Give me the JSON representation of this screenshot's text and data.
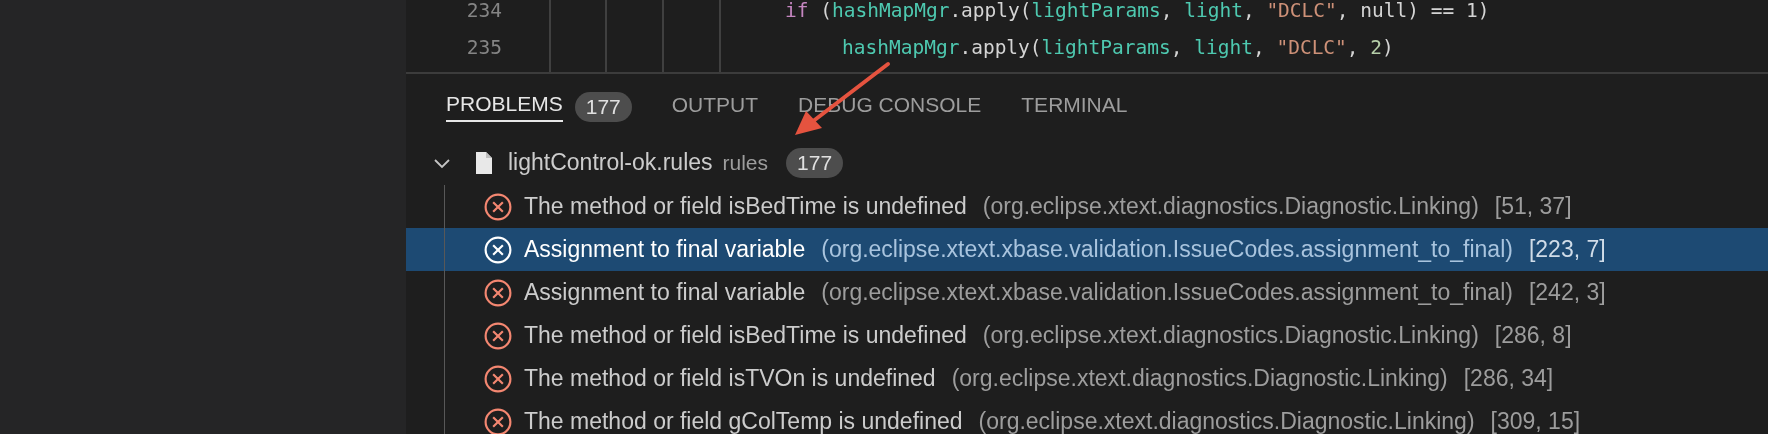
{
  "editor": {
    "lines": [
      {
        "number": "234",
        "code": [
          {
            "kind": "keyword",
            "text": "if"
          },
          {
            "kind": "plain",
            "text": " ("
          },
          {
            "kind": "ident",
            "text": "hashMapMgr"
          },
          {
            "kind": "plain",
            "text": ".apply("
          },
          {
            "kind": "ident",
            "text": "lightParams"
          },
          {
            "kind": "plain",
            "text": ", "
          },
          {
            "kind": "ident",
            "text": "light"
          },
          {
            "kind": "plain",
            "text": ", "
          },
          {
            "kind": "string",
            "text": "\"DCLC\""
          },
          {
            "kind": "plain",
            "text": ", null) == 1)"
          }
        ]
      },
      {
        "number": "235",
        "code": [
          {
            "kind": "ident",
            "text": "hashMapMgr"
          },
          {
            "kind": "plain",
            "text": ".apply("
          },
          {
            "kind": "ident",
            "text": "lightParams"
          },
          {
            "kind": "plain",
            "text": ", "
          },
          {
            "kind": "ident",
            "text": "light"
          },
          {
            "kind": "plain",
            "text": ", "
          },
          {
            "kind": "string",
            "text": "\"DCLC\""
          },
          {
            "kind": "plain",
            "text": ", "
          },
          {
            "kind": "number",
            "text": "2"
          },
          {
            "kind": "plain",
            "text": ")"
          }
        ]
      }
    ]
  },
  "panel": {
    "tabs": [
      {
        "label": "PROBLEMS",
        "selected": true,
        "badge": "177"
      },
      {
        "label": "OUTPUT",
        "selected": false
      },
      {
        "label": "DEBUG CONSOLE",
        "selected": false
      },
      {
        "label": "TERMINAL",
        "selected": false
      }
    ],
    "file": {
      "name": "lightControl-ok.rules",
      "detail": "rules",
      "count": "177",
      "expanded": true
    },
    "problems": [
      {
        "message": "The method or field isBedTime is undefined",
        "code": "(org.eclipse.xtext.diagnostics.Diagnostic.Linking)",
        "position": "[51, 37]",
        "selected": false
      },
      {
        "message": "Assignment to final variable",
        "code": "(org.eclipse.xtext.xbase.validation.IssueCodes.assignment_to_final)",
        "position": "[223, 7]",
        "selected": true
      },
      {
        "message": "Assignment to final variable",
        "code": "(org.eclipse.xtext.xbase.validation.IssueCodes.assignment_to_final)",
        "position": "[242, 3]",
        "selected": false
      },
      {
        "message": "The method or field isBedTime is undefined",
        "code": "(org.eclipse.xtext.diagnostics.Diagnostic.Linking)",
        "position": "[286, 8]",
        "selected": false
      },
      {
        "message": "The method or field isTVOn is undefined",
        "code": "(org.eclipse.xtext.diagnostics.Diagnostic.Linking)",
        "position": "[286, 34]",
        "selected": false
      },
      {
        "message": "The method or field gColTemp is undefined",
        "code": "(org.eclipse.xtext.diagnostics.Diagnostic.Linking)",
        "position": "[309, 15]",
        "selected": false
      }
    ]
  }
}
